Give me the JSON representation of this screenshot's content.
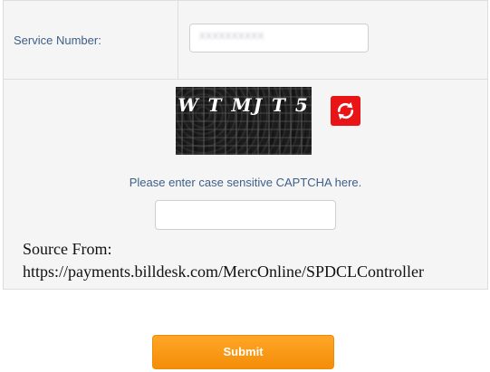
{
  "service": {
    "label": "Service Number:",
    "value": "XXXXXXXXXX"
  },
  "captcha": {
    "image_text": "W T MJ T 5",
    "refresh_icon": "refresh-icon",
    "hint": "Please enter case sensitive CAPTCHA here.",
    "input_value": ""
  },
  "source": {
    "line1": "Source From:",
    "line2": "https://payments.billdesk.com/MercOnline/SPDCLController"
  },
  "submit": {
    "label": "Submit"
  },
  "colors": {
    "label_blue": "#3d5f8a",
    "refresh_red": "#e81416",
    "submit_orange": "#f7941d"
  }
}
